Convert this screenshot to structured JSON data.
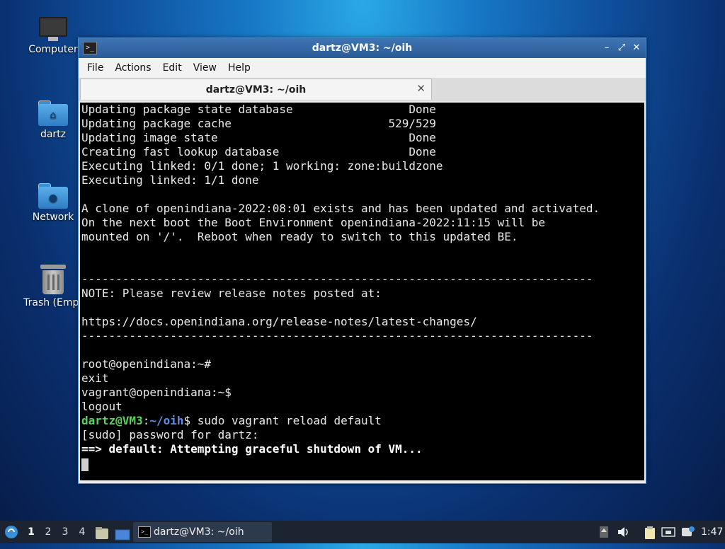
{
  "desktop": {
    "icons": [
      {
        "label": "Computer"
      },
      {
        "label": "dartz"
      },
      {
        "label": "Network"
      },
      {
        "label": "Trash (Empt"
      }
    ]
  },
  "window": {
    "title": "dartz@VM3: ~/oih",
    "icon": "terminal-icon",
    "controls": {
      "minimize": "minimize-icon",
      "maximize": "maximize-icon",
      "close": "close-icon"
    }
  },
  "menu": [
    "File",
    "Actions",
    "Edit",
    "View",
    "Help"
  ],
  "tab": {
    "label": "dartz@VM3: ~/oih",
    "close_glyph": "✕"
  },
  "terminal": {
    "lines": [
      "Updating package state database                 Done",
      "Updating package cache                       529/529",
      "Updating image state                            Done",
      "Creating fast lookup database                   Done",
      "Executing linked: 0/1 done; 1 working: zone:buildzone",
      "Executing linked: 1/1 done",
      "",
      "A clone of openindiana-2022:08:01 exists and has been updated and activated.",
      "On the next boot the Boot Environment openindiana-2022:11:15 will be",
      "mounted on '/'.  Reboot when ready to switch to this updated BE.",
      "",
      "",
      "---------------------------------------------------------------------------",
      "NOTE: Please review release notes posted at:",
      "",
      "https://docs.openindiana.org/release-notes/latest-changes/",
      "---------------------------------------------------------------------------",
      "",
      "root@openindiana:~#",
      "exit",
      "vagrant@openindiana:~$",
      "logout"
    ],
    "prompt_user": "dartz@VM3",
    "prompt_sep": ":",
    "prompt_path": "~/oih",
    "prompt_symbol": "$",
    "command": " sudo vagrant reload default",
    "sudo_line": "[sudo] password for dartz:",
    "status_line": "==> default: Attempting graceful shutdown of VM..."
  },
  "taskbar": {
    "workspaces": [
      "1",
      "2",
      "3",
      "4"
    ],
    "active_workspace": "1",
    "app_label": "dartz@VM3: ~/oih",
    "clock": "1:47"
  },
  "colors": {
    "prompt_green": "#5ad35a",
    "prompt_blue": "#5b8ff0",
    "titlebar": "#2f64a4"
  }
}
